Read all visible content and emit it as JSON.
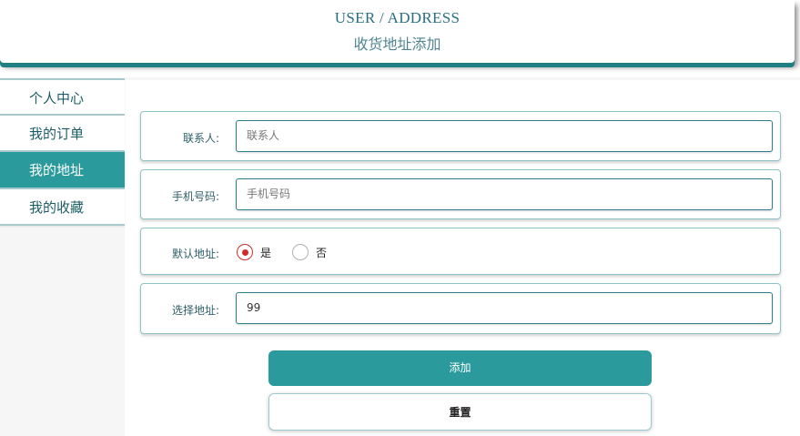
{
  "header": {
    "title_en": "USER / ADDRESS",
    "title_cn": "收货地址添加"
  },
  "sidebar": {
    "items": [
      {
        "label": "个人中心",
        "active": false
      },
      {
        "label": "我的订单",
        "active": false
      },
      {
        "label": "我的地址",
        "active": true
      },
      {
        "label": "我的收藏",
        "active": false
      }
    ]
  },
  "form": {
    "contact": {
      "label": "联系人:",
      "placeholder": "联系人",
      "value": ""
    },
    "phone": {
      "label": "手机号码:",
      "placeholder": "手机号码",
      "value": ""
    },
    "default_address": {
      "label": "默认地址:",
      "options": [
        {
          "label": "是",
          "checked": true
        },
        {
          "label": "否",
          "checked": false
        }
      ]
    },
    "address": {
      "label": "选择地址:",
      "value": "99"
    }
  },
  "buttons": {
    "add_label": "添加",
    "reset_label": "重置"
  },
  "colors": {
    "accent": "#2a9a9c",
    "header_shadow": "#1f7f82",
    "radio_checked": "#d22b2b"
  }
}
